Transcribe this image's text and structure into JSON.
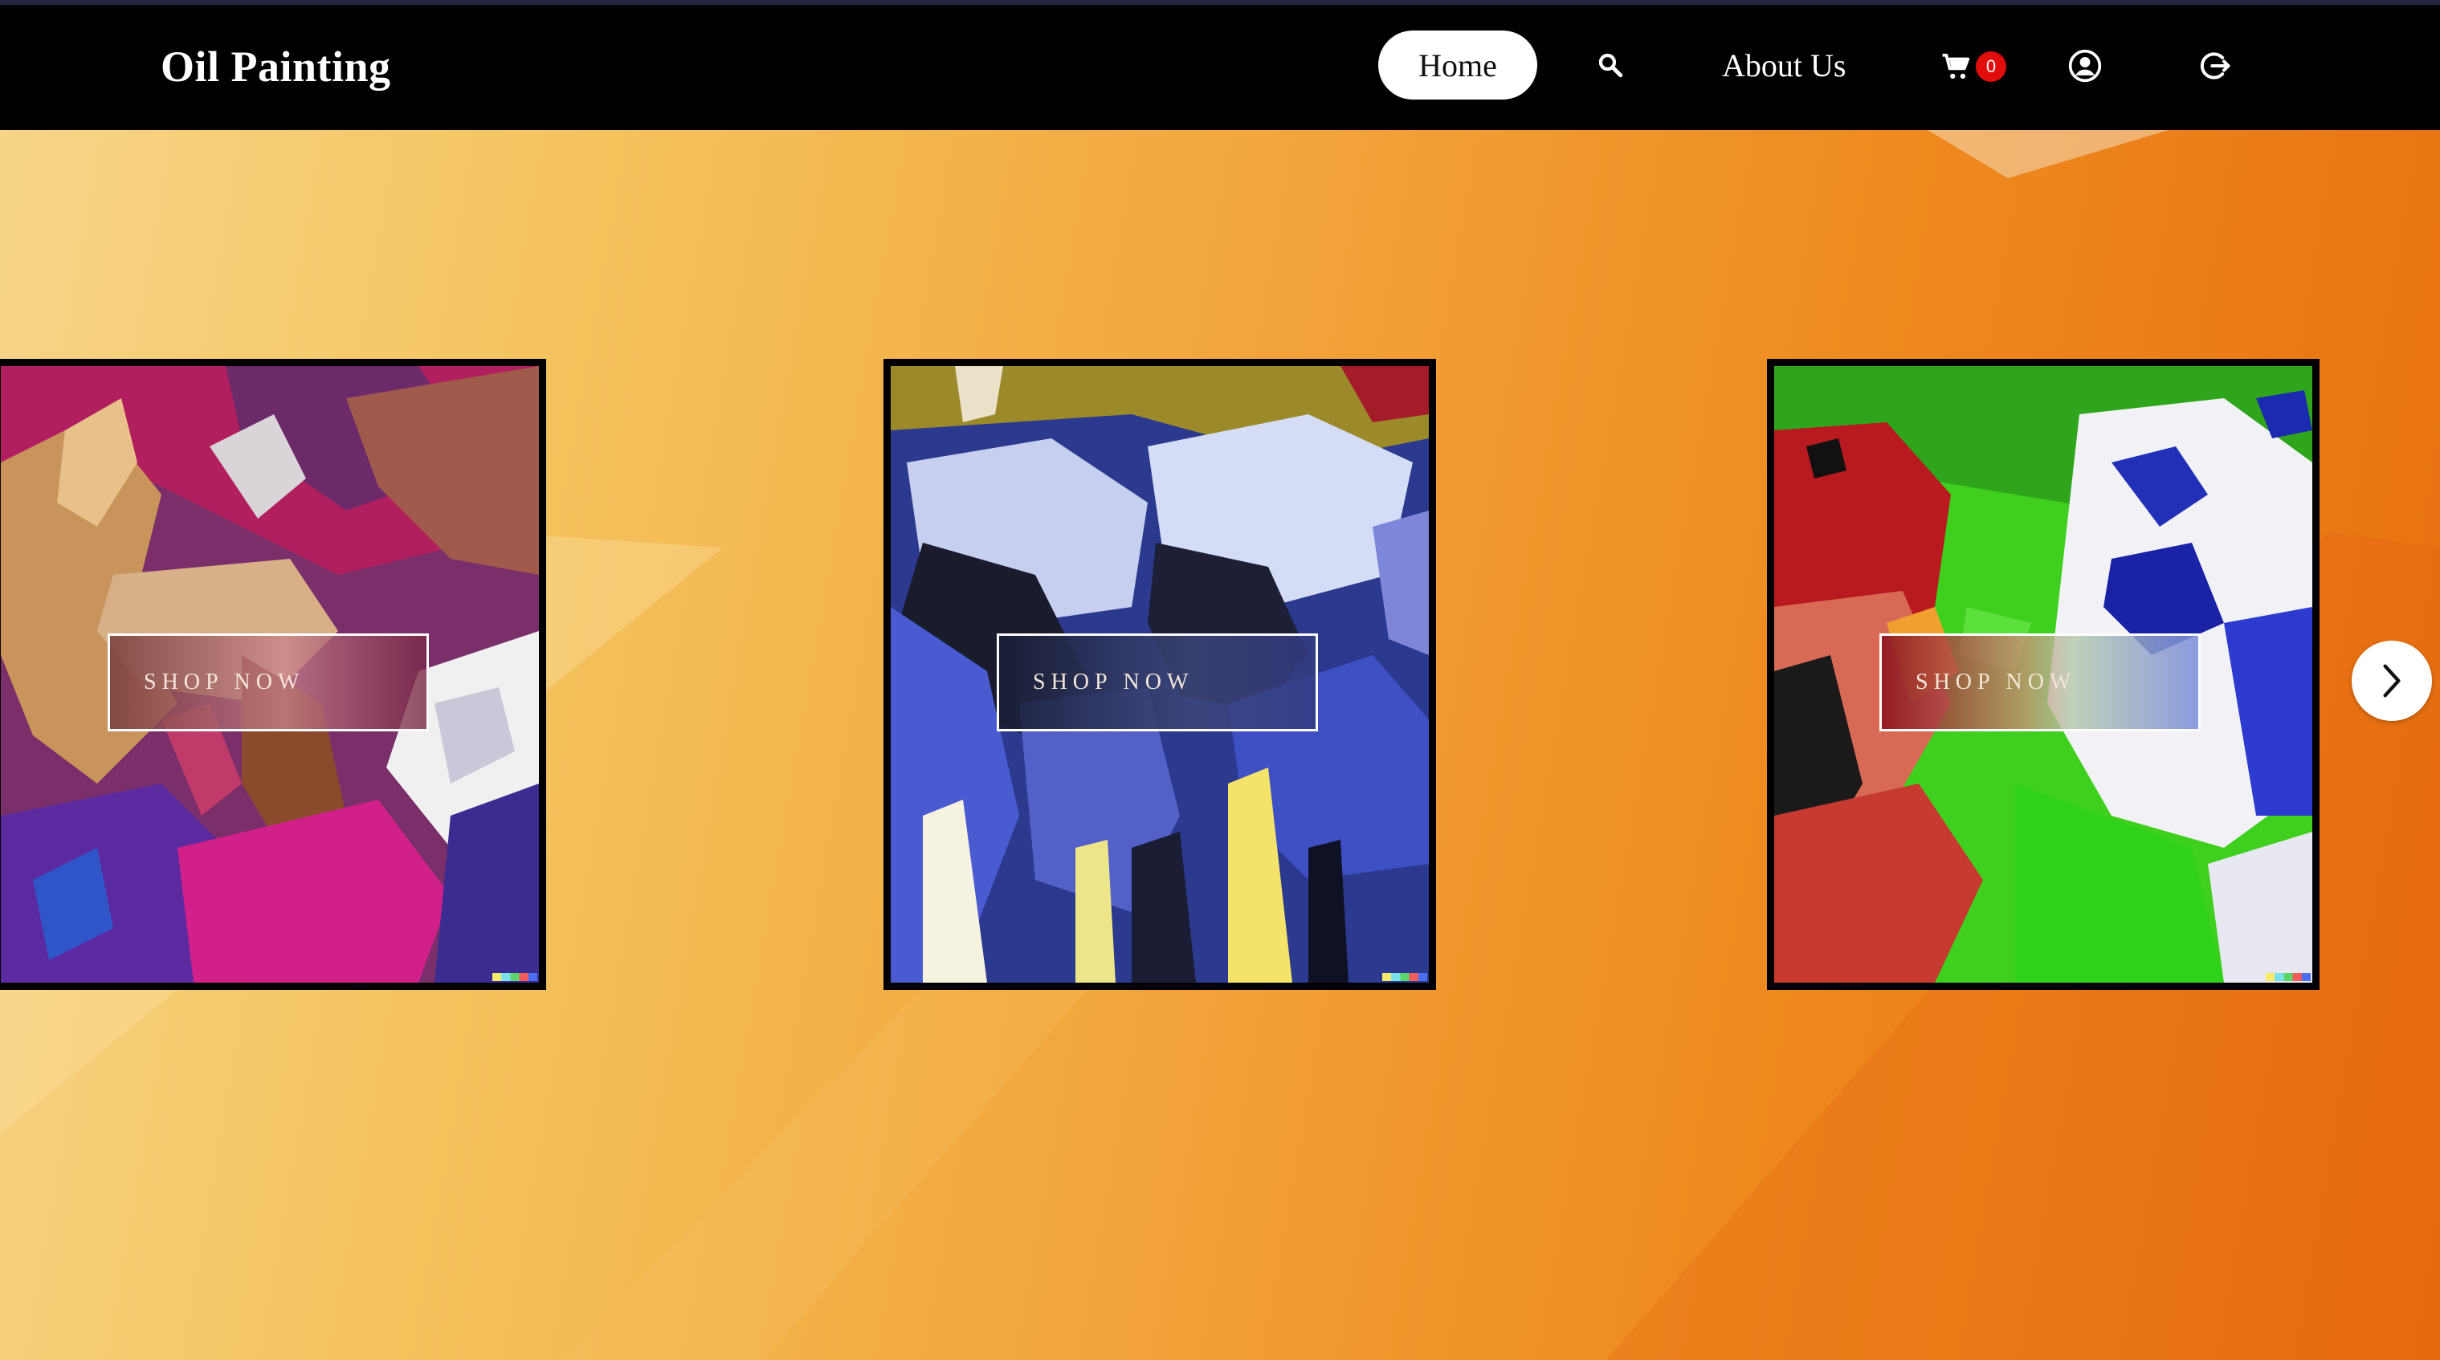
{
  "header": {
    "brand": "Oil Painting",
    "nav": {
      "home_label": "Home",
      "about_label": "About Us",
      "cart_count": "0"
    },
    "icons": [
      "search-icon",
      "cart-icon",
      "account-icon",
      "logout-icon"
    ]
  },
  "carousel": {
    "cards": [
      {
        "button_label": "SHOP NOW",
        "art": "horses-painting"
      },
      {
        "button_label": "SHOP NOW",
        "art": "sheep-painting"
      },
      {
        "button_label": "SHOP NOW",
        "art": "abstract-animal-painting"
      }
    ],
    "next_icon": "chevron-right-icon"
  },
  "colors": {
    "nav_background": "#000000",
    "cart_badge": "#e10d0d",
    "background_start": "#f6d58a",
    "background_end": "#e86d0e"
  }
}
